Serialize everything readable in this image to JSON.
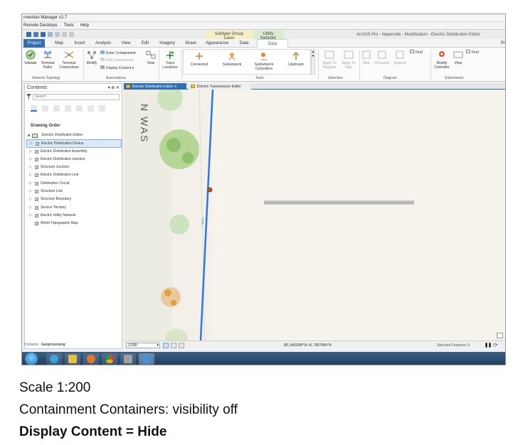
{
  "window": {
    "title": "nnection Manager v2.7",
    "menu": [
      "Remote Desktops",
      "Tools",
      "Help"
    ]
  },
  "app": {
    "title": "ArcGIS Pro - Naperville - Modification - Electric Distribution Editor",
    "contextual_tabs": {
      "subtype_group_layer": "Subtype Group Layer",
      "utility_network": "Utility Network"
    },
    "ribbon_tabs": [
      "Project",
      "Map",
      "Insert",
      "Analysis",
      "View",
      "Edit",
      "Imagery",
      "Share",
      "Appearance",
      "Data",
      "Data"
    ],
    "far_right_fragment": "Pr"
  },
  "ribbon": {
    "network_topology": {
      "label": "Network Topology",
      "tools": [
        "Validate",
        "Terminal Paths",
        "Terminal Connections"
      ]
    },
    "associations": {
      "label": "Associations",
      "modify": "Modify",
      "enter_containment": "Enter Containment",
      "exit_containment": "Exit Containment",
      "display_content": "Display Content",
      "view": "View"
    },
    "trace": {
      "trace_locations": "Trace Locations"
    },
    "tools": {
      "label": "Tools",
      "items": [
        "Connected",
        "Subnetwork",
        "Subnetwork Controllers",
        "Upstream"
      ]
    },
    "selection": {
      "label": "Selection",
      "apply_to_diagram": "Apply To Diagram",
      "apply_to_map": "Apply To Map"
    },
    "diagram": {
      "label": "Diagram",
      "items": [
        "New",
        "Overwrite",
        "Append",
        "Find"
      ]
    },
    "subnetwork": {
      "label": "Subnetwork",
      "modify_controller": "Modify Controller",
      "view": "View",
      "find": "Find"
    }
  },
  "contents": {
    "title": "Contents",
    "search_placeholder": "Search",
    "drawing_order": "Drawing Order",
    "root": "Electric Distribution Editor",
    "layers": [
      "Electric Distribution Device",
      "Electric Distribution Assembly",
      "Electric Distribution Junction",
      "Structure Junction",
      "Electric Distribution Line",
      "Distribution Circuit",
      "Structure Line",
      "Structure Boundary",
      "Service Territory",
      "Electric Utility Network",
      "World Topographic Map"
    ],
    "bottom_tabs": [
      "Contents",
      "Geoprocessing"
    ]
  },
  "map_tabs": [
    "Electric Distribution Editor",
    "Electric Transmission Editor"
  ],
  "map": {
    "street_label": "N WAS",
    "line_label": "MAIN"
  },
  "status": {
    "scale": "1:200",
    "coords": "88.1469389°W 41.7887984°N",
    "selected_features": "Selected Features: 0"
  },
  "caption": {
    "line1": "Scale 1:200",
    "line2": "Containment Containers: visibility off",
    "line3": "Display Content = Hide"
  },
  "colors": {
    "accent": "#2f6fb2",
    "line": "#2b78e4",
    "tree": "#8fc06a",
    "device": "#c85a18"
  }
}
